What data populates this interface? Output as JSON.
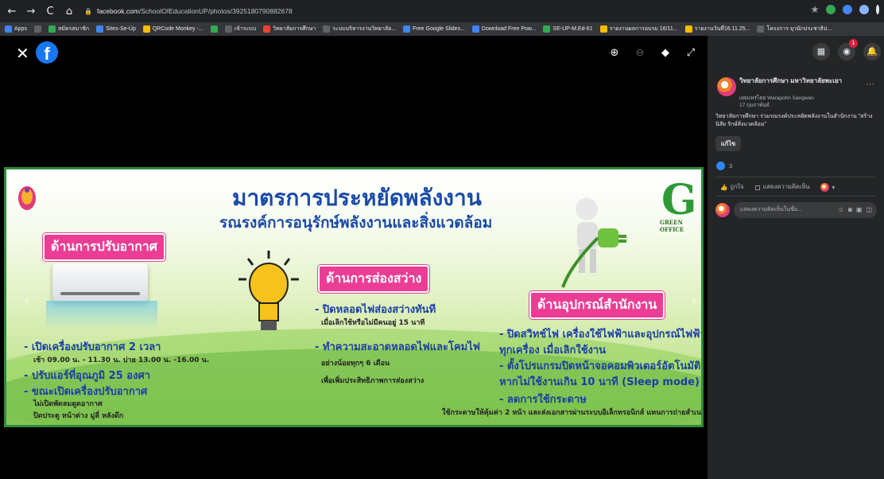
{
  "browser": {
    "url_host": "facebook.com",
    "url_path": "/SchoolOfEducationUP/photos/3925180790882678",
    "bookmarks": [
      {
        "label": "Apps",
        "color": "#4285f4"
      },
      {
        "label": "",
        "color": "#5f6368"
      },
      {
        "label": "สมัครสมาชิก",
        "color": "#34a853"
      },
      {
        "label": "Sites-Se-Up",
        "color": "#4285f4"
      },
      {
        "label": "QRCode Monkey -...",
        "color": "#fbbc04"
      },
      {
        "label": "",
        "color": "#34a853"
      },
      {
        "label": "เข้าระบบ",
        "color": "#5f6368"
      },
      {
        "label": "วิทยาลัยการศึกษา",
        "color": "#ea4335"
      },
      {
        "label": "ระบบบริหารงานวิทยาลัย...",
        "color": "#5f6368"
      },
      {
        "label": "Free Google Slides...",
        "color": "#4285f4"
      },
      {
        "label": "Download Free Pow...",
        "color": "#4285f4"
      },
      {
        "label": "SE-UP-M.Ed-61",
        "color": "#34a853"
      },
      {
        "label": "รายงานผลการอบรม 16/11...",
        "color": "#fbbc04"
      },
      {
        "label": "รายงานวันที่16.11.25...",
        "color": "#fbbc04"
      },
      {
        "label": "โครงการ ยุวนักประชาธิป...",
        "color": "#5f6368"
      }
    ]
  },
  "banner": {
    "title": "มาตรการประหยัดพลังงาน",
    "subtitle": "รณรงค์การอนุรักษ์พลังงานและสิ่งแวดล้อม",
    "green_office": "GREEN OFFICE",
    "section_ac": "ด้านการปรับอากาศ",
    "section_light": "ด้านการส่องสว่าง",
    "section_equip": "ด้านอุปกรณ์สำนักงาน",
    "ac_lines": [
      "- เปิดเครื่องปรับอากาศ 2 เวลา",
      "เช้า 09.00 น. - 11.30 น. บ่าย 13.00 น. -16.00 น.",
      "- ปรับแอร์ที่อุณภูมิ 25 องศา",
      "- ขณะเปิดเครื่องปรับอากาศ",
      "ไม่เปิดพัดลมดูดอากาศ",
      "ปิดประตู หน้าต่าง มู่ลี่ หลังดึก"
    ],
    "light_lines": [
      "- ปิดหลอดไฟส่องสว่างทันที",
      "เมื่อเลิกใช้หรือไม่มีคนอยู่ 15 นาที",
      "- ทำความสะอาดหลอดไฟและโคมไฟ",
      "อย่างน้อยทุกๆ 6 เดือน",
      "เพื่อเพิ่มประสิทธิภาพการส่องสว่าง"
    ],
    "equip_lines": [
      "- ปิดสวิทช์ไฟ เครื่องใช้ไฟฟ้าและอุปกรณ์ไฟฟ้า",
      "ทุกเครื่อง เมื่อเลิกใช้งาน",
      "- ตั้งโปรแกรมปิดหน้าจอคอมพิวเตอร์อัตโนมัติ",
      "หากไม่ใช้งานเกิน 10 นาที (Sleep mode)",
      "- ลดการใช้กระดาษ",
      "ใช้กระดาษให้คุ้มค่า 2 หน้า และส่งเอกสารผ่านระบบอิเล็กทรอนิกส์ แทนการถ่ายสำเนา"
    ]
  },
  "panel": {
    "page_name": "วิทยาลัยการศึกษา มหาวิทยาลัยพะเยา",
    "posted_by": "เผยแพร่โดย Warapohn Sangwan",
    "date": "17 กุมภาพันธ์ ·",
    "caption": "วิทยาลัยการศึกษา ร่วมรณรงค์ประหยัดพลังงานในสำนักงาน \"สร้างนิสัย รักษ์สิ่งแวดล้อม\"",
    "edit_label": "แก้ไข",
    "reaction_count": "3",
    "like_label": "ถูกใจ",
    "comment_label": "แสดงความคิดเห็น",
    "comment_placeholder": "แสดงความคิดเห็นในชื่อ...",
    "messenger_badge": "1"
  }
}
